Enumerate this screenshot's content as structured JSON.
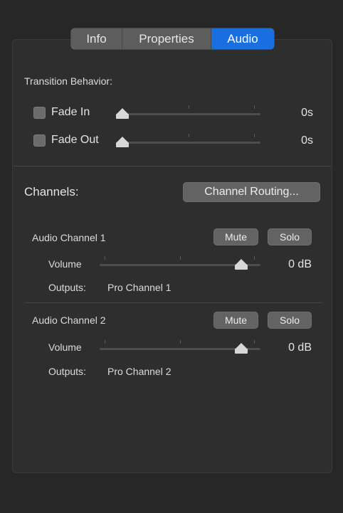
{
  "tabs": {
    "info": "Info",
    "properties": "Properties",
    "audio": "Audio",
    "selected": "Audio"
  },
  "transition": {
    "heading": "Transition Behavior:",
    "fade_in": {
      "label": "Fade In",
      "checked": false,
      "value": "0s",
      "level": 0
    },
    "fade_out": {
      "label": "Fade Out",
      "checked": false,
      "value": "0s",
      "level": 0
    }
  },
  "channels": {
    "heading": "Channels:",
    "routing_button": "Channel Routing...",
    "items": [
      {
        "name": "Audio Channel 1",
        "mute": "Mute",
        "solo": "Solo",
        "volume_label": "Volume",
        "volume_value": "0 dB",
        "outputs_label": "Outputs:",
        "outputs_value": "Pro Channel 1"
      },
      {
        "name": "Audio Channel 2",
        "mute": "Mute",
        "solo": "Solo",
        "volume_label": "Volume",
        "volume_value": "0 dB",
        "outputs_label": "Outputs:",
        "outputs_value": "Pro Channel 2"
      }
    ]
  },
  "colors": {
    "background": "#2e2e2e",
    "accent": "#1a6fe0",
    "button": "#636363",
    "text": "#dcdcdc"
  }
}
